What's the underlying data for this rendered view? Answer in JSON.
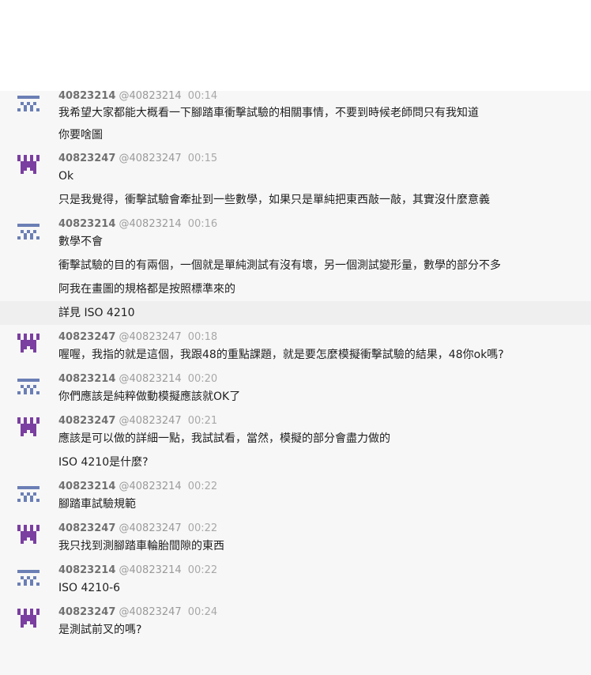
{
  "users": {
    "u14": {
      "name": "40823214",
      "handle": "@40823214",
      "avatar_color": "#6b7fb5"
    },
    "u47": {
      "name": "40823247",
      "handle": "@40823247",
      "avatar_color": "#7a3fa0"
    }
  },
  "messages": [
    {
      "user": "u14",
      "time": "00:14",
      "lines": [
        "我希望大家都能大概看一下腳踏車衝擊試驗的相關事情，不要到時候老師問只有我知道",
        "你要啥圖"
      ]
    },
    {
      "user": "u47",
      "time": "00:15",
      "lines": [
        "Ok",
        "只是我覺得，衝擊試驗會牽扯到一些數學，如果只是單純把東西敲一敲，其實沒什麼意義"
      ]
    },
    {
      "user": "u14",
      "time": "00:16",
      "lines": [
        "數學不會",
        "衝擊試驗的目的有兩個，一個就是單純測試有沒有壞，另一個測試變形量，數學的部分不多",
        "阿我在畫圖的規格都是按照標準來的",
        "詳見 ISO 4210"
      ]
    },
    {
      "user": "u47",
      "time": "00:18",
      "lines": [
        "喔喔，我指的就是這個，我跟48的重點課題，就是要怎麼模擬衝擊試驗的結果，48你ok嗎?"
      ]
    },
    {
      "user": "u14",
      "time": "00:20",
      "lines": [
        "你們應該是純粹做動模擬應該就OK了"
      ]
    },
    {
      "user": "u47",
      "time": "00:21",
      "lines": [
        "應該是可以做的詳細一點，我試試看，當然，模擬的部分會盡力做的",
        "ISO 4210是什麼?"
      ]
    },
    {
      "user": "u14",
      "time": "00:22",
      "lines": [
        "腳踏車試驗規範"
      ]
    },
    {
      "user": "u47",
      "time": "00:22",
      "lines": [
        "我只找到測腳踏車輪胎間隙的東西"
      ]
    },
    {
      "user": "u14",
      "time": "00:22",
      "lines": [
        "ISO 4210-6"
      ]
    },
    {
      "user": "u47",
      "time": "00:24",
      "lines": [
        "是測試前叉的嗎?"
      ]
    }
  ]
}
